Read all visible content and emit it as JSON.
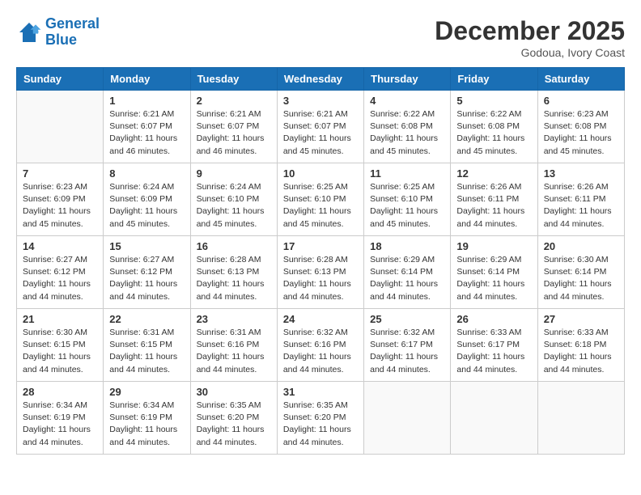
{
  "header": {
    "logo_line1": "General",
    "logo_line2": "Blue",
    "month": "December 2025",
    "location": "Godoua, Ivory Coast"
  },
  "weekdays": [
    "Sunday",
    "Monday",
    "Tuesday",
    "Wednesday",
    "Thursday",
    "Friday",
    "Saturday"
  ],
  "weeks": [
    [
      {
        "day": "",
        "empty": true
      },
      {
        "day": "1",
        "sunrise": "6:21 AM",
        "sunset": "6:07 PM",
        "daylight": "11 hours and 46 minutes."
      },
      {
        "day": "2",
        "sunrise": "6:21 AM",
        "sunset": "6:07 PM",
        "daylight": "11 hours and 46 minutes."
      },
      {
        "day": "3",
        "sunrise": "6:21 AM",
        "sunset": "6:07 PM",
        "daylight": "11 hours and 45 minutes."
      },
      {
        "day": "4",
        "sunrise": "6:22 AM",
        "sunset": "6:08 PM",
        "daylight": "11 hours and 45 minutes."
      },
      {
        "day": "5",
        "sunrise": "6:22 AM",
        "sunset": "6:08 PM",
        "daylight": "11 hours and 45 minutes."
      },
      {
        "day": "6",
        "sunrise": "6:23 AM",
        "sunset": "6:08 PM",
        "daylight": "11 hours and 45 minutes."
      }
    ],
    [
      {
        "day": "7",
        "sunrise": "6:23 AM",
        "sunset": "6:09 PM",
        "daylight": "11 hours and 45 minutes."
      },
      {
        "day": "8",
        "sunrise": "6:24 AM",
        "sunset": "6:09 PM",
        "daylight": "11 hours and 45 minutes."
      },
      {
        "day": "9",
        "sunrise": "6:24 AM",
        "sunset": "6:10 PM",
        "daylight": "11 hours and 45 minutes."
      },
      {
        "day": "10",
        "sunrise": "6:25 AM",
        "sunset": "6:10 PM",
        "daylight": "11 hours and 45 minutes."
      },
      {
        "day": "11",
        "sunrise": "6:25 AM",
        "sunset": "6:10 PM",
        "daylight": "11 hours and 45 minutes."
      },
      {
        "day": "12",
        "sunrise": "6:26 AM",
        "sunset": "6:11 PM",
        "daylight": "11 hours and 44 minutes."
      },
      {
        "day": "13",
        "sunrise": "6:26 AM",
        "sunset": "6:11 PM",
        "daylight": "11 hours and 44 minutes."
      }
    ],
    [
      {
        "day": "14",
        "sunrise": "6:27 AM",
        "sunset": "6:12 PM",
        "daylight": "11 hours and 44 minutes."
      },
      {
        "day": "15",
        "sunrise": "6:27 AM",
        "sunset": "6:12 PM",
        "daylight": "11 hours and 44 minutes."
      },
      {
        "day": "16",
        "sunrise": "6:28 AM",
        "sunset": "6:13 PM",
        "daylight": "11 hours and 44 minutes."
      },
      {
        "day": "17",
        "sunrise": "6:28 AM",
        "sunset": "6:13 PM",
        "daylight": "11 hours and 44 minutes."
      },
      {
        "day": "18",
        "sunrise": "6:29 AM",
        "sunset": "6:14 PM",
        "daylight": "11 hours and 44 minutes."
      },
      {
        "day": "19",
        "sunrise": "6:29 AM",
        "sunset": "6:14 PM",
        "daylight": "11 hours and 44 minutes."
      },
      {
        "day": "20",
        "sunrise": "6:30 AM",
        "sunset": "6:14 PM",
        "daylight": "11 hours and 44 minutes."
      }
    ],
    [
      {
        "day": "21",
        "sunrise": "6:30 AM",
        "sunset": "6:15 PM",
        "daylight": "11 hours and 44 minutes."
      },
      {
        "day": "22",
        "sunrise": "6:31 AM",
        "sunset": "6:15 PM",
        "daylight": "11 hours and 44 minutes."
      },
      {
        "day": "23",
        "sunrise": "6:31 AM",
        "sunset": "6:16 PM",
        "daylight": "11 hours and 44 minutes."
      },
      {
        "day": "24",
        "sunrise": "6:32 AM",
        "sunset": "6:16 PM",
        "daylight": "11 hours and 44 minutes."
      },
      {
        "day": "25",
        "sunrise": "6:32 AM",
        "sunset": "6:17 PM",
        "daylight": "11 hours and 44 minutes."
      },
      {
        "day": "26",
        "sunrise": "6:33 AM",
        "sunset": "6:17 PM",
        "daylight": "11 hours and 44 minutes."
      },
      {
        "day": "27",
        "sunrise": "6:33 AM",
        "sunset": "6:18 PM",
        "daylight": "11 hours and 44 minutes."
      }
    ],
    [
      {
        "day": "28",
        "sunrise": "6:34 AM",
        "sunset": "6:19 PM",
        "daylight": "11 hours and 44 minutes."
      },
      {
        "day": "29",
        "sunrise": "6:34 AM",
        "sunset": "6:19 PM",
        "daylight": "11 hours and 44 minutes."
      },
      {
        "day": "30",
        "sunrise": "6:35 AM",
        "sunset": "6:20 PM",
        "daylight": "11 hours and 44 minutes."
      },
      {
        "day": "31",
        "sunrise": "6:35 AM",
        "sunset": "6:20 PM",
        "daylight": "11 hours and 44 minutes."
      },
      {
        "day": "",
        "empty": true
      },
      {
        "day": "",
        "empty": true
      },
      {
        "day": "",
        "empty": true
      }
    ]
  ],
  "labels": {
    "sunrise": "Sunrise:",
    "sunset": "Sunset:",
    "daylight": "Daylight:"
  }
}
